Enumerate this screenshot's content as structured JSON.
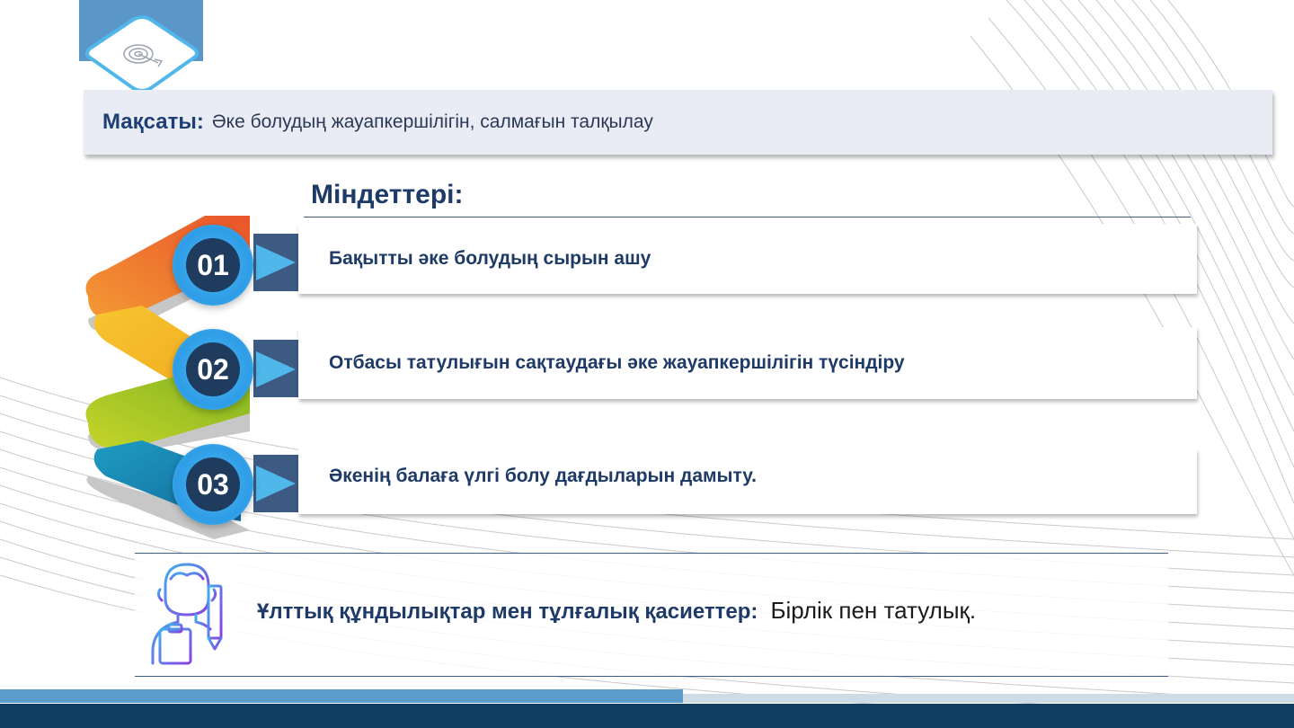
{
  "goal": {
    "label": "Мақсаты:",
    "text": "Әке болудың жауапкершілігін, салмағын талқылау"
  },
  "tasks": {
    "title": "Міндеттері:",
    "items": [
      {
        "number": "01",
        "text": "Бақытты әке болудың сырын ашу"
      },
      {
        "number": "02",
        "text": "Отбасы татулығын сақтаудағы әке жауапкершілігін түсіндіру"
      },
      {
        "number": "03",
        "text": "Әкенің балаға үлгі болу дағдыларын дамыту."
      }
    ]
  },
  "values": {
    "label": "Ұлттық құндылықтар мен тұлғалық қасиеттер:",
    "text": "Бірлік пен татулық."
  },
  "colors": {
    "navy": "#1e3a66",
    "blue_accent": "#2e9de6",
    "ribbon_orange": "#f0702a",
    "ribbon_yellow": "#f5b830",
    "ribbon_green": "#a9c81c",
    "ribbon_teal": "#1d9fbf",
    "bottom_bar": "#0d3d63"
  },
  "icons": {
    "top_tab": "target-icon",
    "values": "person-clipboard-icon"
  }
}
